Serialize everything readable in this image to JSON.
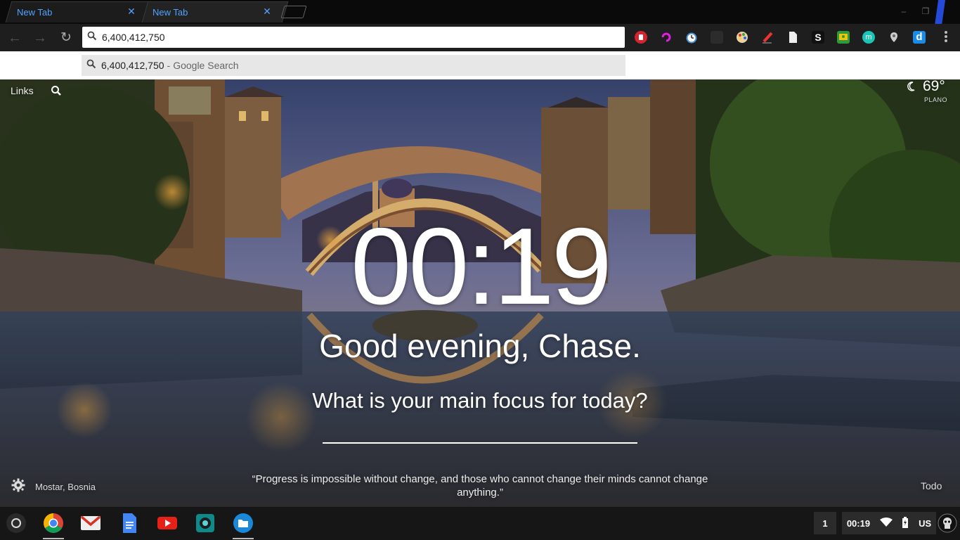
{
  "tabs": [
    {
      "title": "New Tab"
    },
    {
      "title": "New Tab"
    }
  ],
  "omnibox": {
    "value": "6,400,412,750"
  },
  "suggestion": {
    "query": "6,400,412,750",
    "separator": "-",
    "engine": "Google Search"
  },
  "extensions": [
    "stop-extension-icon",
    "rotating-arrow-extension-icon",
    "clock-extension-icon",
    "dark-square-extension-icon",
    "palette-extension-icon",
    "pen-extension-icon",
    "document-extension-icon",
    "s-extension-icon",
    "classroom-extension-icon",
    "mint-m-extension-icon",
    "pin-extension-icon",
    "d-extension-icon"
  ],
  "momentum": {
    "links_label": "Links",
    "temperature": "69°",
    "city": "PLANO",
    "time": "00:19",
    "greeting": "Good evening, Chase.",
    "focus_question": "What is your main focus for today?",
    "location": "Mostar, Bosnia",
    "quote": "“Progress is impossible without change, and those who cannot change their minds cannot change anything.”",
    "todo_label": "Todo"
  },
  "shelf": {
    "apps": [
      "chrome-icon",
      "gmail-icon",
      "docs-icon",
      "youtube-icon",
      "camera-icon",
      "files-icon"
    ],
    "workspace_count": "1",
    "clock": "00:19",
    "keyboard_layout": "US"
  },
  "colors": {
    "tab_text": "#4fa3ff",
    "accent": "#2a56ff"
  }
}
